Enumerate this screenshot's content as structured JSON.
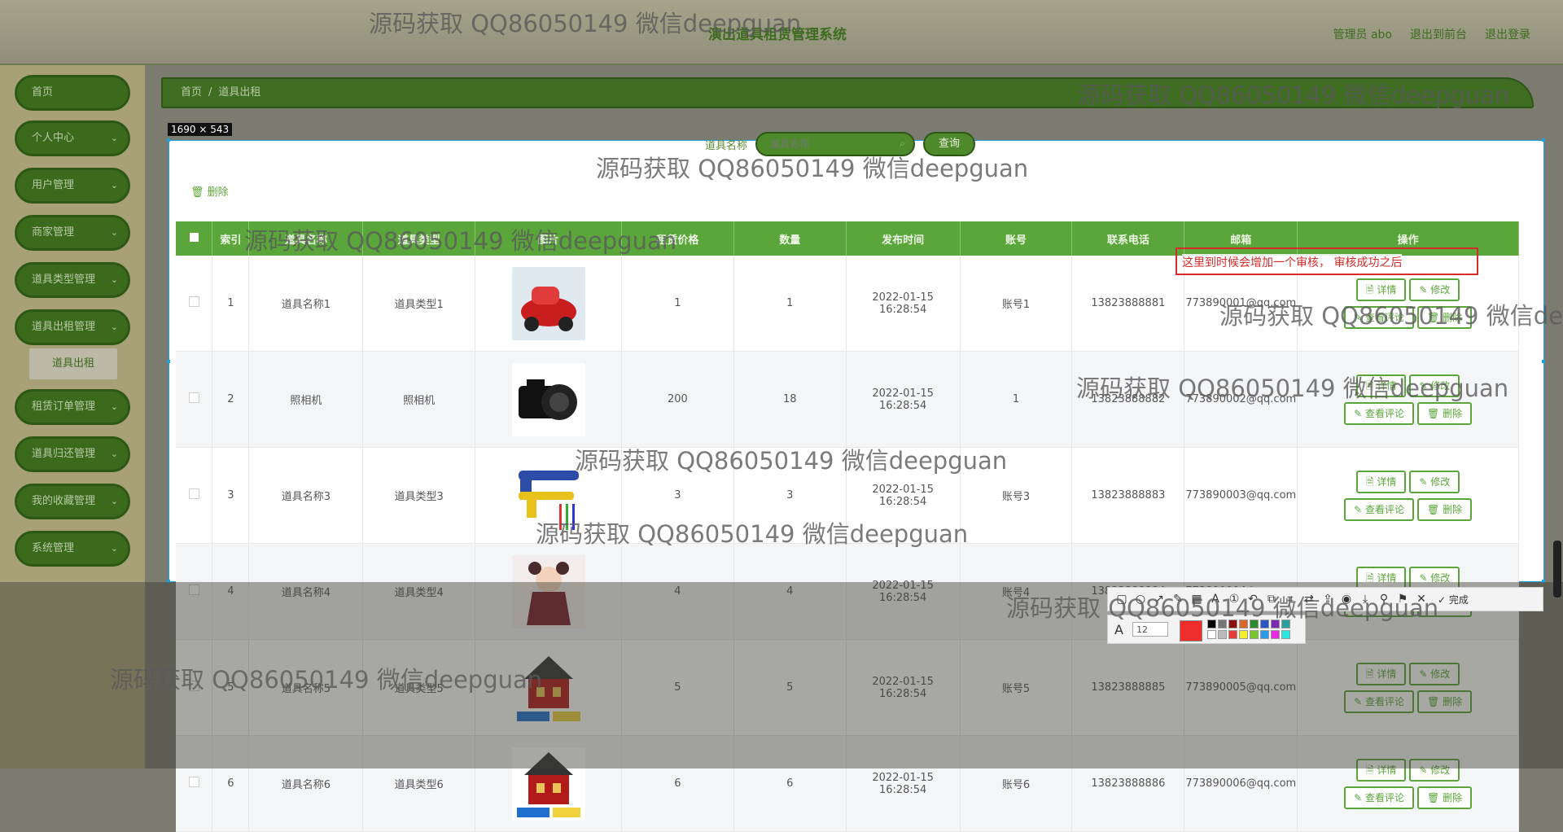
{
  "header": {
    "title": "演出道具租赁管理系统",
    "links": [
      "管理员 abo",
      "退出到前台",
      "退出登录"
    ]
  },
  "sidebar": {
    "items": [
      {
        "label": "首页",
        "chevron": false
      },
      {
        "label": "个人中心",
        "chevron": true
      },
      {
        "label": "用户管理",
        "chevron": true
      },
      {
        "label": "商家管理",
        "chevron": true
      },
      {
        "label": "道具类型管理",
        "chevron": true
      },
      {
        "label": "道具出租管理",
        "chevron": true
      },
      {
        "label": "租赁订单管理",
        "chevron": true
      },
      {
        "label": "道具归还管理",
        "chevron": true
      },
      {
        "label": "我的收藏管理",
        "chevron": true
      },
      {
        "label": "系统管理",
        "chevron": true
      }
    ],
    "submenu_label": "道具出租"
  },
  "breadcrumb": {
    "home": "首页",
    "separator": "/",
    "current": "道具出租"
  },
  "dimension_label": "1690 × 543",
  "search": {
    "label": "道具名称",
    "placeholder": "道具名称",
    "button": "查询"
  },
  "delete_label": "删除",
  "table": {
    "columns": [
      "",
      "索引",
      "道具名称",
      "道具类型",
      "图片",
      "租赁价格",
      "数量",
      "发布时间",
      "账号",
      "联系电话",
      "邮箱",
      "操作"
    ],
    "rows": [
      {
        "index": "1",
        "name": "道具名称1",
        "type": "道具类型1",
        "price": "1",
        "qty": "1",
        "time": "2022-01-15 16:28:54",
        "account": "账号1",
        "phone": "13823888881",
        "email": "773890001@qq.com",
        "image": "red-toy-car"
      },
      {
        "index": "2",
        "name": "照相机",
        "type": "照相机",
        "price": "200",
        "qty": "18",
        "time": "2022-01-15 16:28:54",
        "account": "1",
        "phone": "13823888882",
        "email": "773890002@qq.com",
        "image": "camera"
      },
      {
        "index": "3",
        "name": "道具名称3",
        "type": "道具类型3",
        "price": "3",
        "qty": "3",
        "time": "2022-01-15 16:28:54",
        "account": "账号3",
        "phone": "13823888883",
        "email": "773890003@qq.com",
        "image": "toy-gun"
      },
      {
        "index": "4",
        "name": "道具名称4",
        "type": "道具类型4",
        "price": "4",
        "qty": "4",
        "time": "2022-01-15 16:28:54",
        "account": "账号4",
        "phone": "13823888884",
        "email": "773890004@qq.com",
        "image": "doll"
      },
      {
        "index": "5",
        "name": "道具名称5",
        "type": "道具类型5",
        "price": "5",
        "qty": "5",
        "time": "2022-01-15 16:28:54",
        "account": "账号5",
        "phone": "13823888885",
        "email": "773890005@qq.com",
        "image": "lego-castle"
      },
      {
        "index": "6",
        "name": "道具名称6",
        "type": "道具类型6",
        "price": "6",
        "qty": "6",
        "time": "2022-01-15 16:28:54",
        "account": "账号6",
        "phone": "13823888886",
        "email": "773890006@qq.com",
        "image": "lego-castle"
      }
    ],
    "actions": [
      "详情",
      "修改",
      "查看评论",
      "删除"
    ]
  },
  "annotation": {
    "text": "这里到时候会增加一个审核， 审核成功之后",
    "color": "#d72b2b"
  },
  "screenshot_toolbar": {
    "done_label": "完成",
    "font_size": "12",
    "current_color": "#f02d2d"
  },
  "watermark": "源码获取 QQ86050149 微信deepguan",
  "colors": {
    "accent": "#5aa63a",
    "dark_green": "#3b6a1d",
    "annotation": "#d72b2b"
  }
}
